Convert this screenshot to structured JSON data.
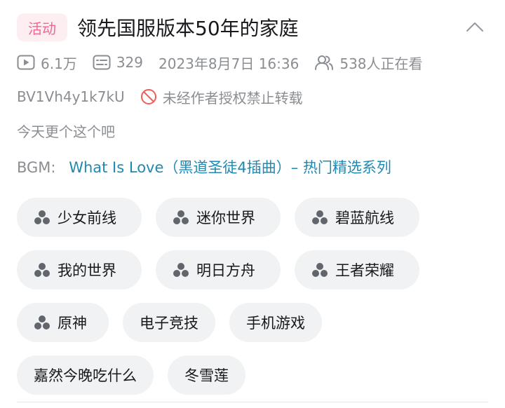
{
  "header": {
    "badge": "活动",
    "title": "领先国服版本50年的家庭",
    "collapse_icon": "chevron-up-icon"
  },
  "stats": {
    "views": "6.1万",
    "danmaku": "329",
    "datetime": "2023年8月7日 16:36",
    "watching": "538人正在看"
  },
  "meta": {
    "bvid": "BV1Vh4y1k7kU",
    "reprint_notice": "未经作者授权禁止转载"
  },
  "description": "今天更个这个吧",
  "bgm": {
    "label": "BGM:",
    "track": "What Is Love（黑道圣徒4插曲）– 热门精选系列"
  },
  "tags": {
    "row1": [
      "少女前线",
      "迷你世界",
      "碧蓝航线"
    ],
    "row2": [
      "我的世界",
      "明日方舟",
      "王者荣耀"
    ],
    "row3": [
      "原神",
      "电子竞技",
      "手机游戏"
    ],
    "row4": [
      "嘉然今晚吃什么",
      "冬雪莲"
    ]
  },
  "colors": {
    "badge_bg": "#fdeef2",
    "badge_text": "#f0668f",
    "link": "#1e8ab4",
    "muted": "#8a8d92",
    "tag_bg": "#f1f2f3"
  }
}
